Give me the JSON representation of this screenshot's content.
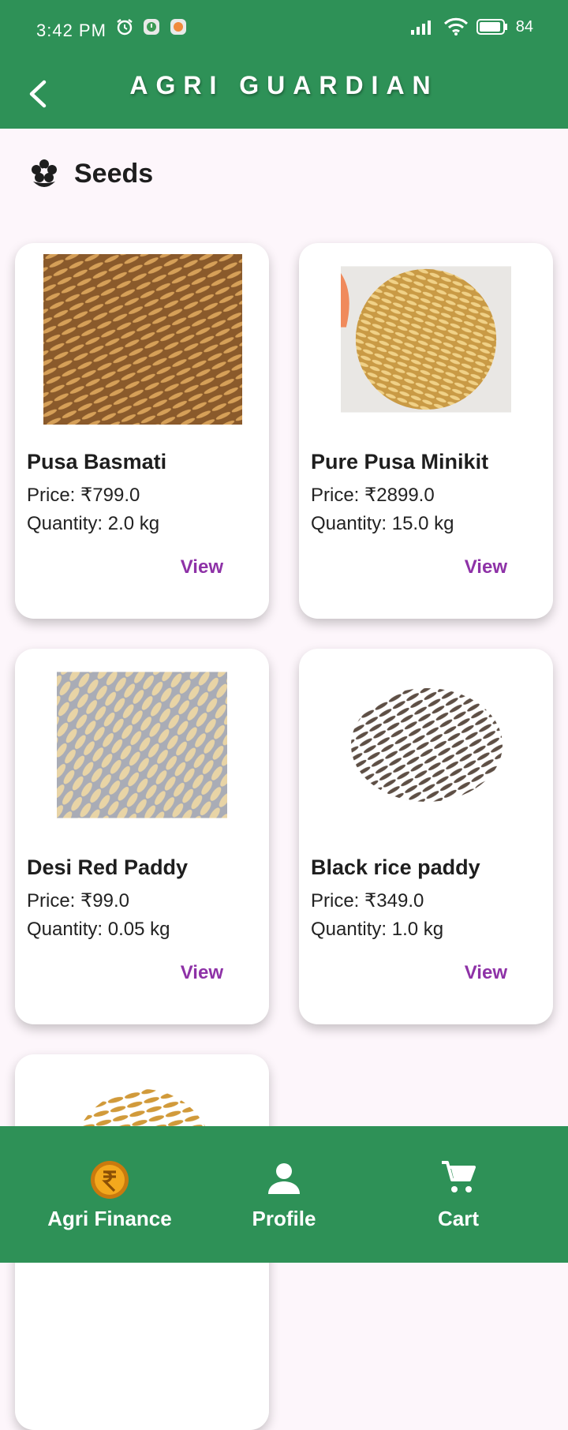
{
  "status_bar": {
    "time": "3:42 PM",
    "battery": "84"
  },
  "app_bar": {
    "title": "AGRI GUARDIAN"
  },
  "section": {
    "title": "Seeds"
  },
  "products": [
    {
      "name": "Pusa Basmati",
      "price": "Price: ₹799.0",
      "quantity": "Quantity: 2.0 kg",
      "action": "View"
    },
    {
      "name": "Pure Pusa Minikit",
      "price": "Price: ₹2899.0",
      "quantity": "Quantity: 15.0 kg",
      "action": "View"
    },
    {
      "name": "Desi Red Paddy",
      "price": "Price: ₹99.0",
      "quantity": "Quantity: 0.05 kg",
      "action": "View"
    },
    {
      "name": "Black rice paddy",
      "price": "Price: ₹349.0",
      "quantity": "Quantity: 1.0 kg",
      "action": "View"
    }
  ],
  "bottom_nav": [
    {
      "label": "Agri Finance",
      "icon": "rupee-coin-icon"
    },
    {
      "label": "Profile",
      "icon": "person-icon"
    },
    {
      "label": "Cart",
      "icon": "cart-icon"
    }
  ],
  "colors": {
    "primary": "#2e9157",
    "accent": "#8e32a7",
    "background": "#fdf6fb"
  }
}
